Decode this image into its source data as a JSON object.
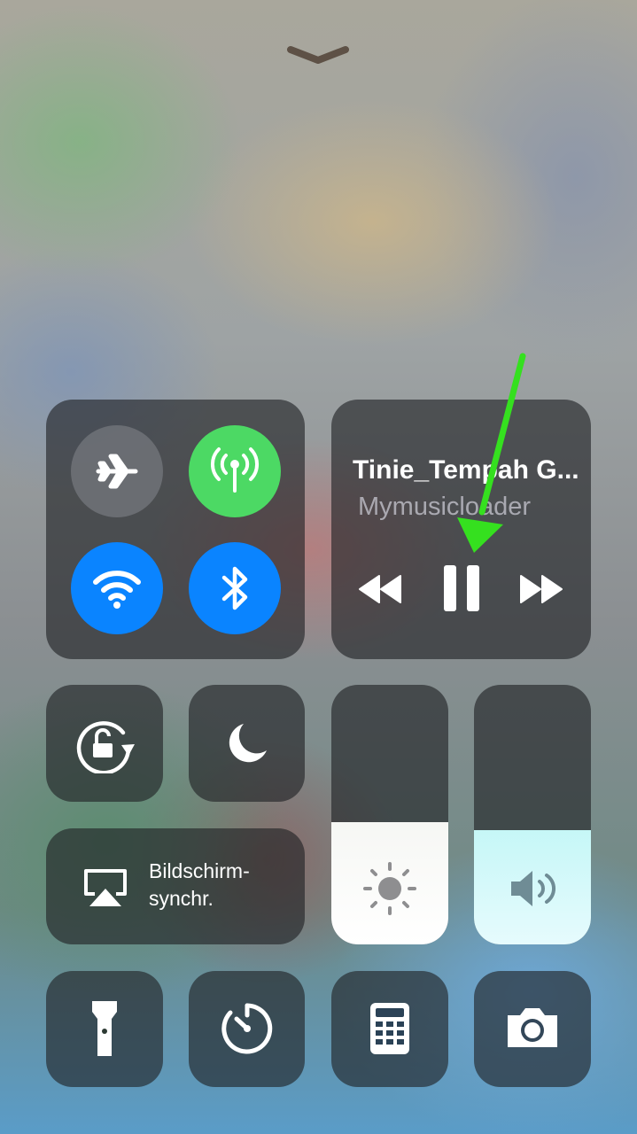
{
  "now_playing": {
    "title": "Tinie_Tempah G...",
    "source": "Mymusicloader",
    "is_playing": true
  },
  "screen_mirroring": {
    "line1": "Bildschirm-",
    "line2": "synchr."
  },
  "connectivity": {
    "airplane_mode": false,
    "cellular_data": true,
    "wifi": true,
    "bluetooth": true
  },
  "brightness_level": 0.47,
  "volume_level": 0.44,
  "colors": {
    "cellular_on": "#4cd964",
    "toggle_blue": "#0a84ff",
    "annotation_arrow": "#35e01f"
  },
  "icons": [
    "chevron-down-icon",
    "airplane-icon",
    "cellular-antenna-icon",
    "wifi-icon",
    "bluetooth-icon",
    "rewind-icon",
    "pause-icon",
    "fast-forward-icon",
    "rotation-lock-icon",
    "moon-icon",
    "airplay-screen-icon",
    "sun-icon",
    "speaker-icon",
    "flashlight-icon",
    "timer-icon",
    "calculator-icon",
    "camera-icon"
  ]
}
